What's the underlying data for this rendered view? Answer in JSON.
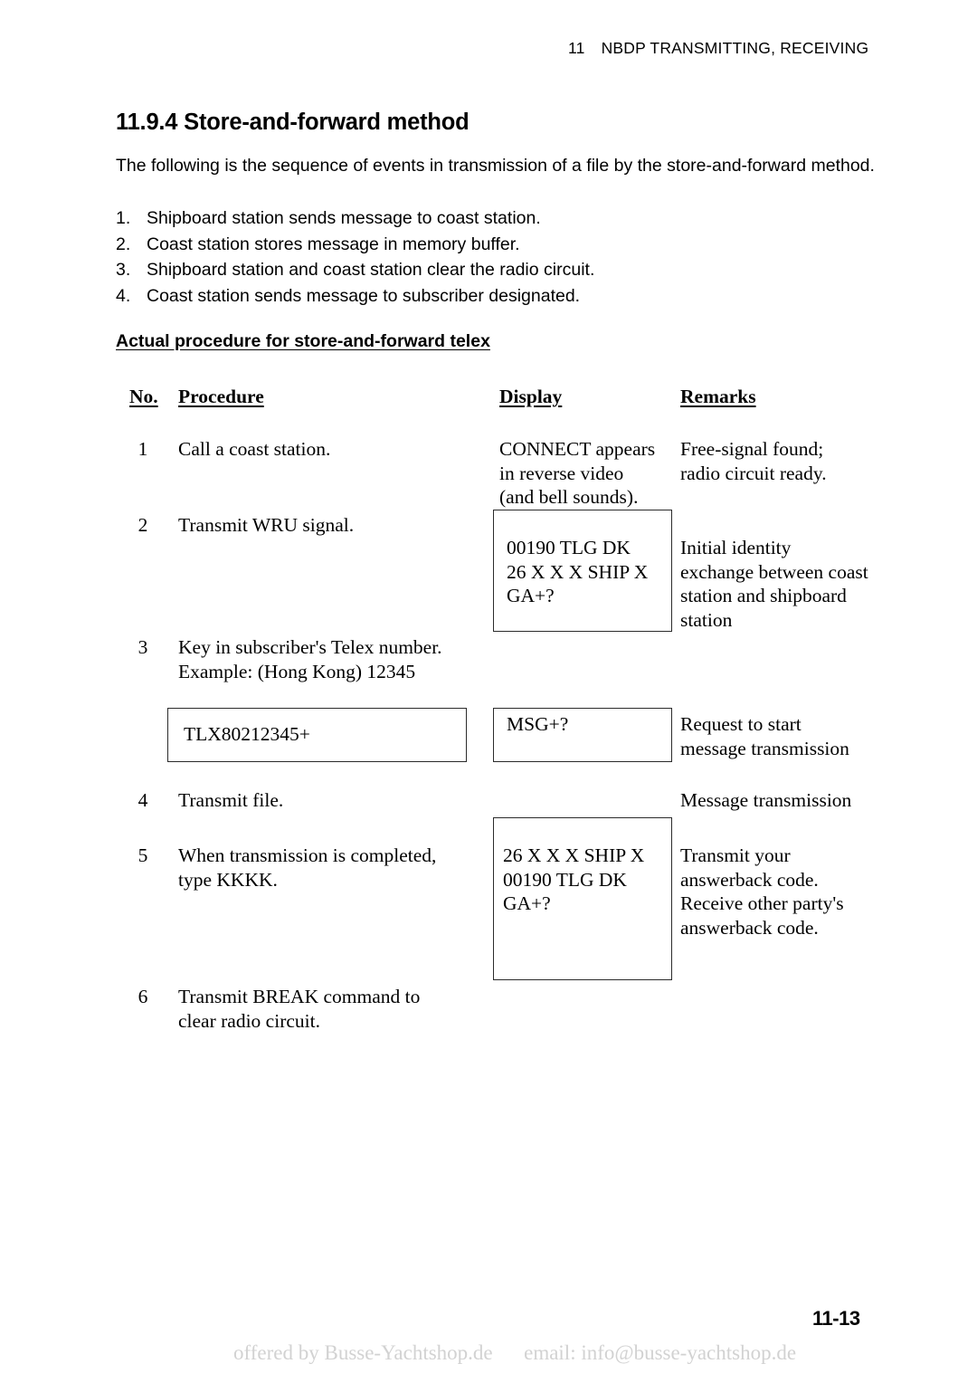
{
  "document": {
    "running_header": {
      "chapter_number": "11",
      "chapter_title": "NBDP TRANSMITTING, RECEIVING"
    },
    "section": {
      "number_and_title": "11.9.4 Store-and-forward method",
      "intro": "The following is the sequence of events in transmission of a file by the store-and-forward method."
    },
    "sequence_list": [
      {
        "num": "1.",
        "text": "Shipboard station sends message to coast station."
      },
      {
        "num": "2.",
        "text": "Coast station stores message in memory buffer."
      },
      {
        "num": "3.",
        "text": "Shipboard station and coast station clear the radio circuit."
      },
      {
        "num": "4.",
        "text": "Coast station sends message to subscriber designated."
      }
    ],
    "subheading": "Actual procedure for store-and-forward telex",
    "table": {
      "headers": {
        "no": "No.",
        "procedure": "Procedure",
        "display": "Display",
        "remarks": "Remarks"
      },
      "rows": [
        {
          "no": "1",
          "procedure": "Call a coast station.",
          "display": "CONNECT appears\nin reverse video\n(and bell sounds).",
          "display_boxed": false,
          "remarks": "Free-signal found;\nradio circuit ready."
        },
        {
          "no": "2",
          "procedure": "Transmit WRU signal.",
          "display": "00190 TLG DK\n26 X X X SHIP X\nGA+?",
          "display_boxed": true,
          "remarks": "Initial identity\nexchange between coast\nstation and shipboard\nstation"
        },
        {
          "no": "3",
          "procedure": "Key in subscriber's Telex number.\nExample: (Hong Kong) 12345",
          "procedure_boxed_value": "TLX80212345+",
          "display": "MSG+?",
          "display_boxed": true,
          "remarks": "Request to start\nmessage transmission"
        },
        {
          "no": "4",
          "procedure": "Transmit file.",
          "display": "",
          "display_boxed": false,
          "remarks": "Message transmission"
        },
        {
          "no": "5",
          "procedure": "When transmission is completed,\ntype KKKK.",
          "display": "26 X X X SHIP X\n00190 TLG DK\nGA+?",
          "display_boxed": true,
          "remarks": "Transmit your\nanswerback code.\nReceive other party's\nanswerback code."
        },
        {
          "no": "6",
          "procedure": "Transmit BREAK command to\nclear radio circuit.",
          "display": "",
          "display_boxed": false,
          "remarks": ""
        }
      ]
    },
    "footer": {
      "page_number": "11-13",
      "watermark": "offered by Busse-Yachtshop.de      email: info@busse-yachtshop.de"
    },
    "colors": {
      "text": "#000000",
      "box_border": "#2b2b2b",
      "watermark": "#d2d2d2",
      "page_background": "#ffffff"
    }
  }
}
